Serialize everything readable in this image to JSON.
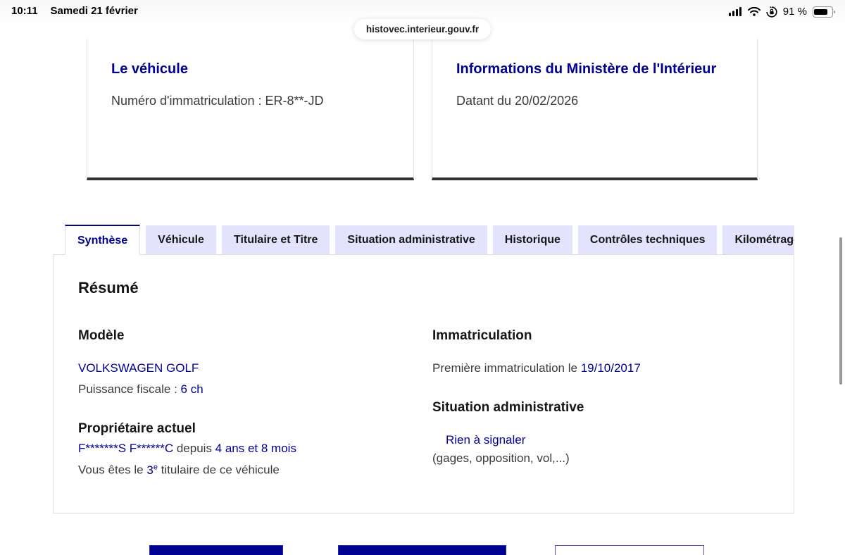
{
  "status_bar": {
    "time": "10:11",
    "date": "Samedi 21 février",
    "battery_percent": "91 %",
    "icons": {
      "cellular": "cellular-signal-icon (4 bars)",
      "wifi": "wifi-icon",
      "rotation_lock": "rotation-lock-icon",
      "battery": "battery-icon"
    }
  },
  "browser": {
    "url": "histovec.interieur.gouv.fr"
  },
  "cards": [
    {
      "title": "Le véhicule",
      "body": "Numéro d'immatriculation : ER-8**-JD"
    },
    {
      "title": "Informations du Ministère de l'Intérieur",
      "body": "Datant du 20/02/2026"
    }
  ],
  "tabs": [
    {
      "label": "Synthèse",
      "active": true
    },
    {
      "label": "Véhicule",
      "active": false
    },
    {
      "label": "Titulaire et Titre",
      "active": false
    },
    {
      "label": "Situation administrative",
      "active": false
    },
    {
      "label": "Historique",
      "active": false
    },
    {
      "label": "Contrôles techniques",
      "active": false
    },
    {
      "label": "Kilométrage",
      "active": false,
      "clipped": true
    }
  ],
  "summary": {
    "title": "Résumé",
    "model": {
      "heading": "Modèle",
      "vehicle": "VOLKSWAGEN GOLF",
      "power_label": "Puissance fiscale : ",
      "power_value": "6 ch"
    },
    "owner": {
      "heading": "Propriétaire actuel",
      "masked_name": "F*******S F******C",
      "since_label": " depuis ",
      "since_value": "4 ans et 8 mois",
      "holder_prefix": "Vous êtes le ",
      "holder_rank": "3",
      "holder_rank_sup": "e",
      "holder_suffix": " titulaire de ce véhicule"
    },
    "registration": {
      "heading": "Immatriculation",
      "first_label": "Première immatriculation le ",
      "first_date": "19/10/2017"
    },
    "admin_status": {
      "heading": "Situation administrative",
      "status": "Rien à signaler",
      "note": "(gages, opposition, vol,...)"
    }
  },
  "colors": {
    "brand_blue": "#000091",
    "tab_inactive_bg": "#e3e3fd",
    "text_dark": "#161616",
    "text_gray": "#3a3a3a"
  }
}
